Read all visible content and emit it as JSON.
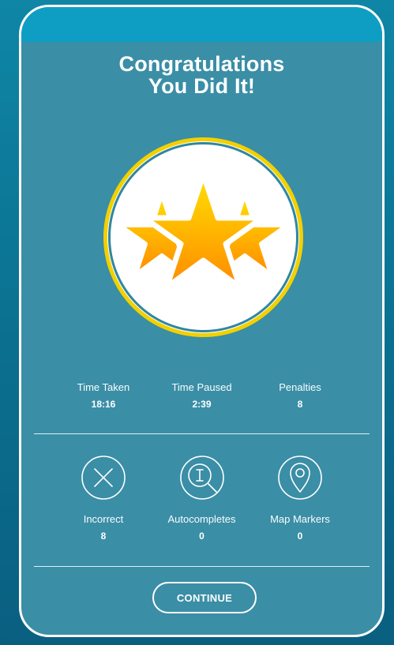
{
  "title": {
    "line1": "Congratulations",
    "line2": "You Did It!"
  },
  "medal": {
    "stars": 3,
    "icon": "three-stars-medal-icon",
    "colors": {
      "ring": "#f3d000",
      "fill": "#ffffff",
      "star_light": "#ffe100",
      "star_dark": "#ff8a00"
    }
  },
  "stats": [
    {
      "label": "Time Taken",
      "value": "18:16"
    },
    {
      "label": "Time Paused",
      "value": "2:39"
    },
    {
      "label": "Penalties",
      "value": "8"
    }
  ],
  "help_stats": [
    {
      "label": "Incorrect",
      "value": "8",
      "icon": "x-circle-icon"
    },
    {
      "label": "Autocompletes",
      "value": "0",
      "icon": "magnifier-info-icon"
    },
    {
      "label": "Map Markers",
      "value": "0",
      "icon": "map-pin-icon"
    }
  ],
  "continue_label": "CONTINUE",
  "colors": {
    "card_bg": "#3a8ea6",
    "card_top": "#0aa0c7",
    "page_bg": "#0b6f8f",
    "text": "#ffffff"
  }
}
